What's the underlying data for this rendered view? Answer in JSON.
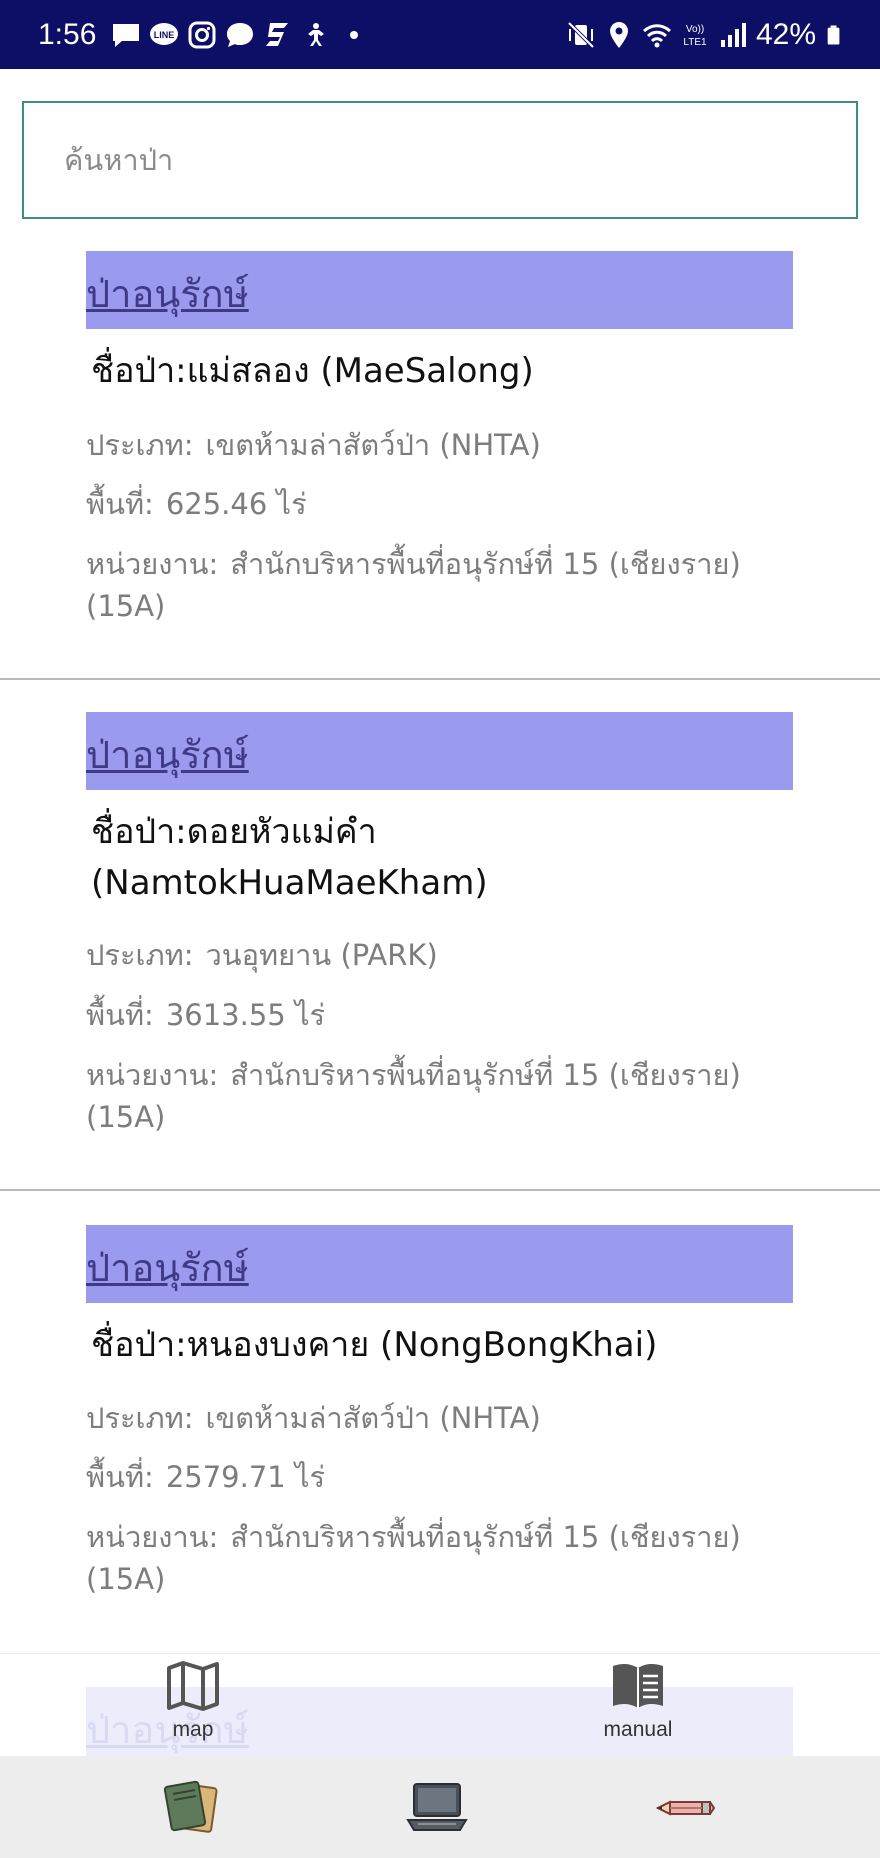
{
  "status_bar": {
    "time": "1:56",
    "battery": "42%",
    "left_icons": [
      "message-icon",
      "line-icon",
      "instagram-icon",
      "chat-bubble-icon",
      "s-app-icon",
      "accessibility-icon",
      "dot-icon"
    ],
    "right_icons": [
      "mute-vibrate-icon",
      "location-icon",
      "wifi-icon",
      "volte-icon",
      "signal-icon",
      "battery-icon"
    ],
    "volte_label": "Vo)) LTE1"
  },
  "search": {
    "placeholder": "ค้นหาป่า",
    "value": ""
  },
  "forests": [
    {
      "tag": "ป่าอนุรักษ์",
      "name": "ชื่อป่า:แม่สลอง (MaeSalong)",
      "type_label": "ประเภท:",
      "type_value": "เขตห้ามล่าสัตว์ป่า (NHTA)",
      "area_label": "พื้นที่:",
      "area_value": "625.46 ไร่",
      "agency_label": "หน่วยงาน:",
      "agency_value": "สำนักบริหารพื้นที่อนุรักษ์ที่ 15 (เชียงราย) (15A)"
    },
    {
      "tag": "ป่าอนุรักษ์",
      "name": "ชื่อป่า:ดอยหัวแม่คำ (NamtokHuaMaeKham)",
      "type_label": "ประเภท:",
      "type_value": "วนอุทยาน (PARK)",
      "area_label": "พื้นที่:",
      "area_value": "3613.55 ไร่",
      "agency_label": "หน่วยงาน:",
      "agency_value": "สำนักบริหารพื้นที่อนุรักษ์ที่ 15 (เชียงราย) (15A)"
    },
    {
      "tag": "ป่าอนุรักษ์",
      "name": "ชื่อป่า:หนองบงคาย (NongBongKhai)",
      "type_label": "ประเภท:",
      "type_value": "เขตห้ามล่าสัตว์ป่า (NHTA)",
      "area_label": "พื้นที่:",
      "area_value": "2579.71 ไร่",
      "agency_label": "หน่วยงาน:",
      "agency_value": "สำนักบริหารพื้นที่อนุรักษ์ที่ 15 (เชียงราย) (15A)"
    },
    {
      "tag": "ป่าอนุรักษ์"
    }
  ],
  "top_nav": {
    "map_label": "map",
    "manual_label": "manual",
    "map_icon": "map-icon",
    "manual_icon": "book-icon"
  },
  "bottom_nav": {
    "icons": [
      "books-icon",
      "laptop-icon",
      "pencil-icon"
    ]
  },
  "colors": {
    "status_bar": "#0d0f66",
    "tag_background": "#9a9bee",
    "tag_text": "#3f3a86",
    "search_border": "#3e8f82",
    "field_text": "#7d7d7d",
    "bottom_bar": "#ededed"
  }
}
